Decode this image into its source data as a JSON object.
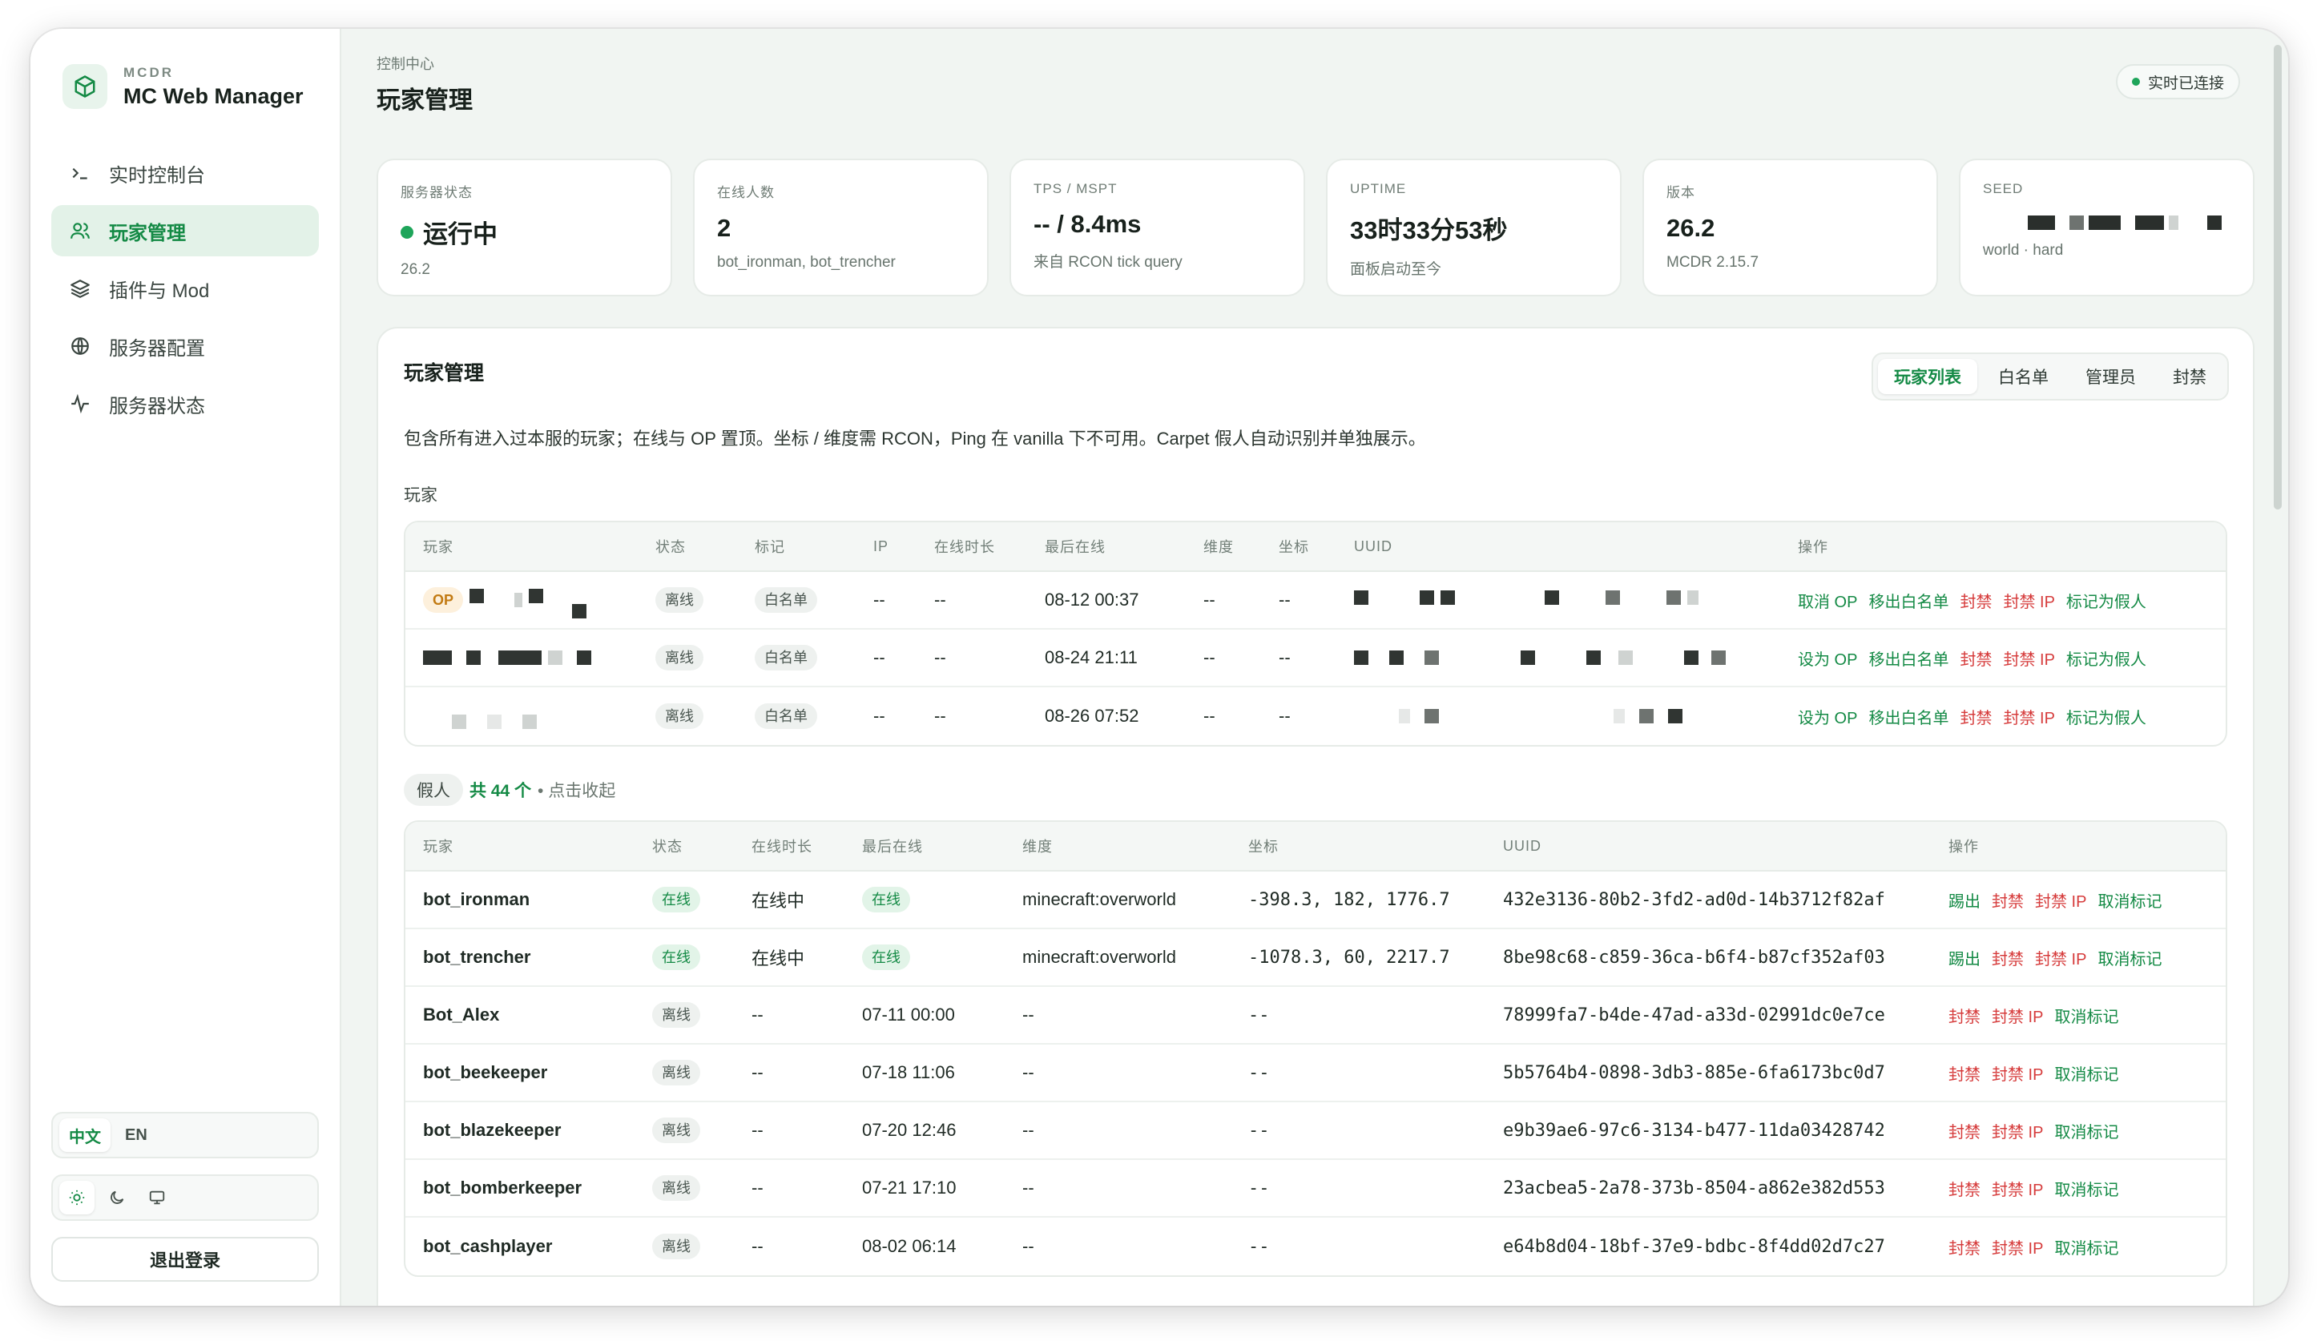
{
  "brand": {
    "subtitle": "MCDR",
    "title": "MC Web Manager"
  },
  "sidebar": {
    "items": [
      {
        "label": "实时控制台",
        "icon": "terminal-icon"
      },
      {
        "label": "玩家管理",
        "icon": "users-icon",
        "active": true
      },
      {
        "label": "插件与 Mod",
        "icon": "layers-icon"
      },
      {
        "label": "服务器配置",
        "icon": "globe-icon"
      },
      {
        "label": "服务器状态",
        "icon": "activity-icon"
      }
    ],
    "lang": {
      "zh": "中文",
      "en": "EN"
    },
    "logout": "退出登录"
  },
  "header": {
    "breadcrumb": "控制中心",
    "title": "玩家管理",
    "live": "实时已连接"
  },
  "stats": {
    "status": {
      "label": "服务器状态",
      "value": "运行中",
      "sub": "26.2"
    },
    "online": {
      "label": "在线人数",
      "value": "2",
      "sub": "bot_ironman, bot_trencher"
    },
    "tps": {
      "label": "TPS / MSPT",
      "value": "-- / 8.4ms",
      "sub": "来自 RCON tick query"
    },
    "uptime": {
      "label": "UPTIME",
      "value": "33时33分53秒",
      "sub": "面板启动至今"
    },
    "version": {
      "label": "版本",
      "value": "26.2",
      "sub": "MCDR 2.15.7"
    },
    "seed": {
      "label": "SEED",
      "sub": "world · hard"
    }
  },
  "panel": {
    "title": "玩家管理",
    "tabs": [
      "玩家列表",
      "白名单",
      "管理员",
      "封禁"
    ],
    "description": "包含所有进入过本服的玩家；在线与 OP 置顶。坐标 / 维度需 RCON，Ping 在 vanilla 下不可用。Carpet 假人自动识别并单独展示。",
    "players_label": "玩家",
    "players_headers": [
      "玩家",
      "状态",
      "标记",
      "IP",
      "在线时长",
      "最后在线",
      "维度",
      "坐标",
      "UUID",
      "操作"
    ],
    "players": [
      {
        "op_badge": "OP",
        "status": "离线",
        "mark": "白名单",
        "ip": "--",
        "duration": "--",
        "last": "08-12 00:37",
        "dim": "--",
        "coord": "--",
        "actions": [
          "取消 OP",
          "移出白名单",
          "封禁",
          "封禁 IP",
          "标记为假人"
        ]
      },
      {
        "op_badge": "",
        "status": "离线",
        "mark": "白名单",
        "ip": "--",
        "duration": "--",
        "last": "08-24 21:11",
        "dim": "--",
        "coord": "--",
        "actions": [
          "设为 OP",
          "移出白名单",
          "封禁",
          "封禁 IP",
          "标记为假人"
        ]
      },
      {
        "op_badge": "",
        "status": "离线",
        "mark": "白名单",
        "ip": "--",
        "duration": "--",
        "last": "08-26 07:52",
        "dim": "--",
        "coord": "--",
        "actions": [
          "设为 OP",
          "移出白名单",
          "封禁",
          "封禁 IP",
          "标记为假人"
        ]
      }
    ],
    "fake": {
      "tag": "假人",
      "count": "共 44 个",
      "hint": "• 点击收起",
      "headers": [
        "玩家",
        "状态",
        "在线时长",
        "最后在线",
        "维度",
        "坐标",
        "UUID",
        "操作"
      ],
      "rows": [
        {
          "name": "bot_ironman",
          "status": "在线",
          "online": true,
          "duration": "在线中",
          "last": "在线",
          "dim": "minecraft:overworld",
          "coord": "-398.3, 182, 1776.7",
          "uuid": "432e3136-80b2-3fd2-ad0d-14b3712f82af",
          "actions": [
            "踢出",
            "封禁",
            "封禁 IP",
            "取消标记"
          ]
        },
        {
          "name": "bot_trencher",
          "status": "在线",
          "online": true,
          "duration": "在线中",
          "last": "在线",
          "dim": "minecraft:overworld",
          "coord": "-1078.3, 60, 2217.7",
          "uuid": "8be98c68-c859-36ca-b6f4-b87cf352af03",
          "actions": [
            "踢出",
            "封禁",
            "封禁 IP",
            "取消标记"
          ]
        },
        {
          "name": "Bot_Alex",
          "status": "离线",
          "online": false,
          "duration": "--",
          "last": "07-11 00:00",
          "dim": "--",
          "coord": "--",
          "uuid": "78999fa7-b4de-47ad-a33d-02991dc0e7ce",
          "actions": [
            "封禁",
            "封禁 IP",
            "取消标记"
          ]
        },
        {
          "name": "bot_beekeeper",
          "status": "离线",
          "online": false,
          "duration": "--",
          "last": "07-18 11:06",
          "dim": "--",
          "coord": "--",
          "uuid": "5b5764b4-0898-3db3-885e-6fa6173bc0d7",
          "actions": [
            "封禁",
            "封禁 IP",
            "取消标记"
          ]
        },
        {
          "name": "bot_blazekeeper",
          "status": "离线",
          "online": false,
          "duration": "--",
          "last": "07-20 12:46",
          "dim": "--",
          "coord": "--",
          "uuid": "e9b39ae6-97c6-3134-b477-11da03428742",
          "actions": [
            "封禁",
            "封禁 IP",
            "取消标记"
          ]
        },
        {
          "name": "bot_bomberkeeper",
          "status": "离线",
          "online": false,
          "duration": "--",
          "last": "07-21 17:10",
          "dim": "--",
          "coord": "--",
          "uuid": "23acbea5-2a78-373b-8504-a862e382d553",
          "actions": [
            "封禁",
            "封禁 IP",
            "取消标记"
          ]
        },
        {
          "name": "bot_cashplayer",
          "status": "离线",
          "online": false,
          "duration": "--",
          "last": "08-02 06:14",
          "dim": "--",
          "coord": "--",
          "uuid": "e64b8d04-18bf-37e9-bdbc-8f4dd02d7c27",
          "actions": [
            "封禁",
            "封禁 IP",
            "取消标记"
          ]
        }
      ]
    }
  },
  "colors": {
    "accent": "#148a45",
    "danger": "#d63b3b",
    "warning": "#c27a12"
  }
}
